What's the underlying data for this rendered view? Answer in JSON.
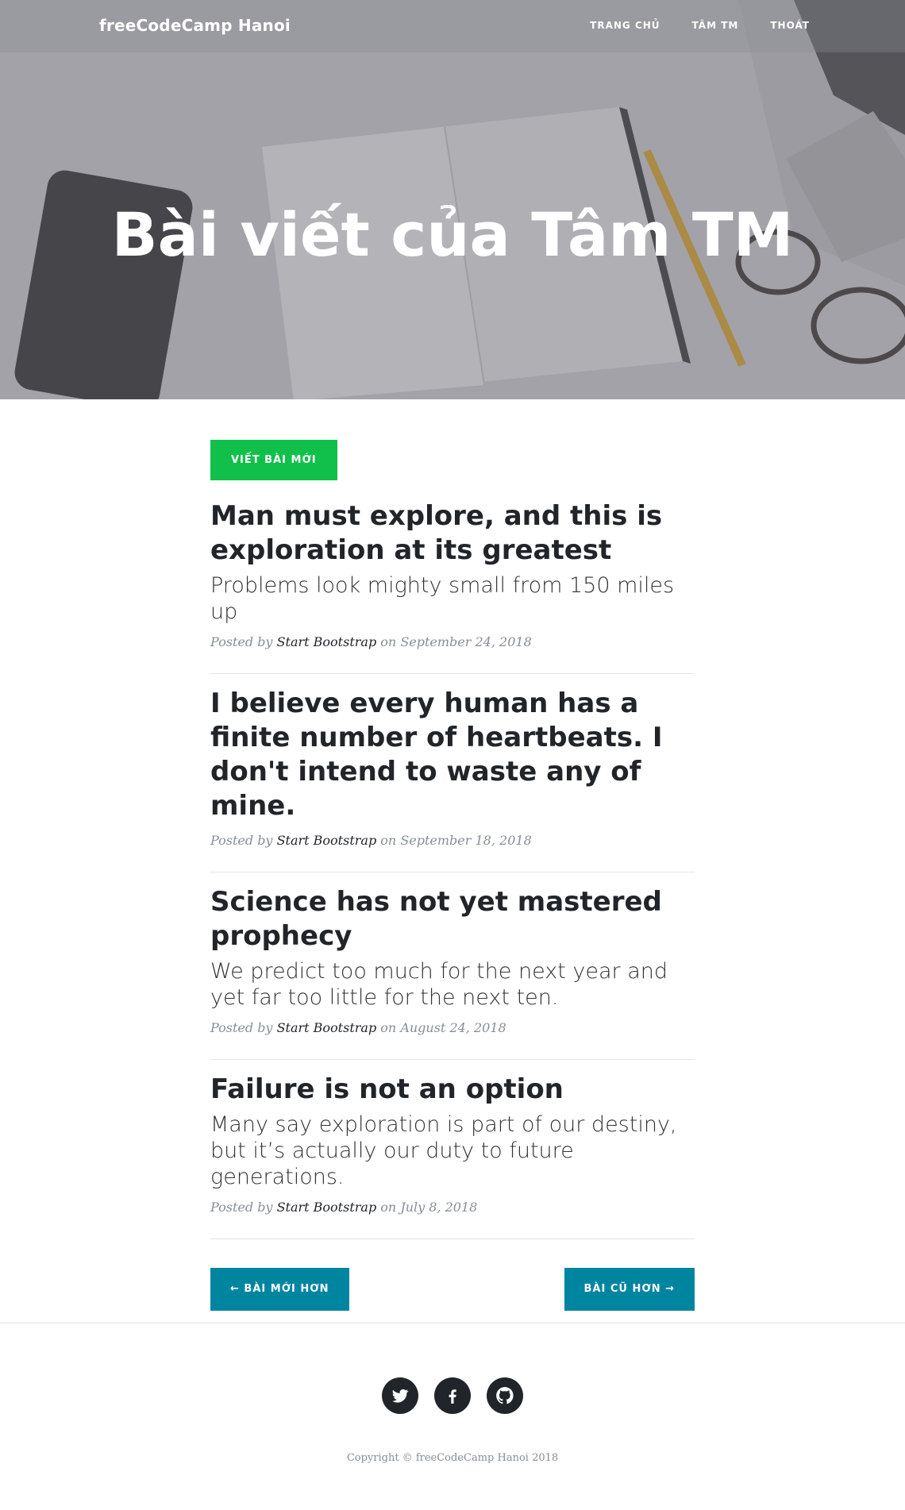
{
  "navbar": {
    "brand": "freeCodeCamp Hanoi",
    "links": [
      "TRANG CHỦ",
      "TÂM TM",
      "THOÁT"
    ]
  },
  "hero": {
    "title": "Bài viết của Tâm TM"
  },
  "actions": {
    "new_post_label": "VIẾT BÀI MỚI"
  },
  "posts": [
    {
      "title": "Man must explore, and this is exploration at its greatest",
      "subtitle": "Problems look mighty small from 150 miles up",
      "posted_by": "Posted by",
      "author": "Start Bootstrap",
      "on": "on",
      "date": "September 24, 2018"
    },
    {
      "title": "I believe every human has a finite number of heartbeats. I don't intend to waste any of mine.",
      "subtitle": "",
      "posted_by": "Posted by",
      "author": "Start Bootstrap",
      "on": "on",
      "date": "September 18, 2018"
    },
    {
      "title": "Science has not yet mastered prophecy",
      "subtitle": "We predict too much for the next year and yet far too little for the next ten.",
      "posted_by": "Posted by",
      "author": "Start Bootstrap",
      "on": "on",
      "date": "August 24, 2018"
    },
    {
      "title": "Failure is not an option",
      "subtitle": "Many say exploration is part of our destiny, but it’s actually our duty to future generations.",
      "posted_by": "Posted by",
      "author": "Start Bootstrap",
      "on": "on",
      "date": "July 8, 2018"
    }
  ],
  "pager": {
    "newer_label": "← BÀI MỚI HƠN",
    "older_label": "BÀI CŨ HƠN →"
  },
  "footer": {
    "social_icons": [
      "twitter-icon",
      "facebook-icon",
      "github-icon"
    ],
    "copyright": "Copyright © freeCodeCamp Hanoi 2018"
  },
  "colors": {
    "new_post_button": "#11c04b",
    "pager_button": "#0085a1",
    "text": "#212529",
    "meta": "#868e96"
  }
}
